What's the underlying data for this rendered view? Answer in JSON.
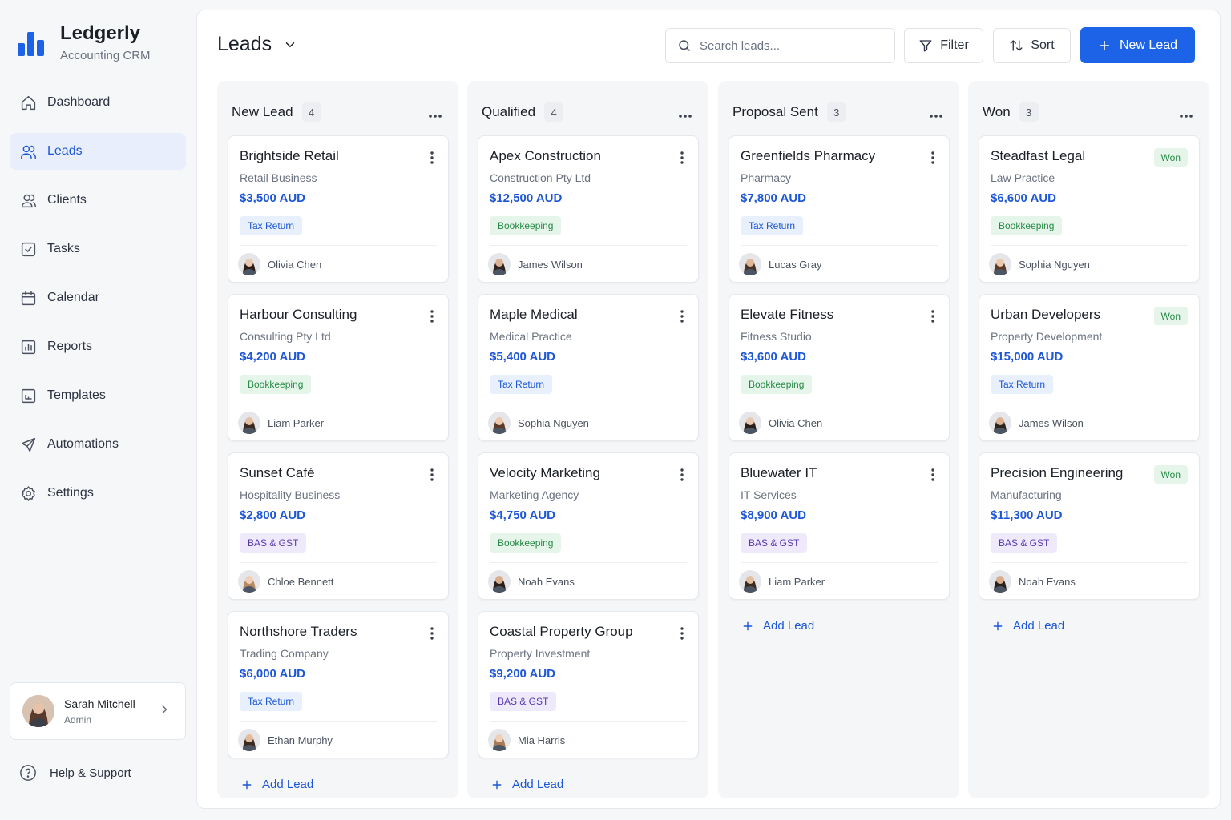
{
  "app": {
    "name": "Ledgerly",
    "subtitle": "Accounting CRM",
    "brand_color": "#1d63e8"
  },
  "sidebar": {
    "items": [
      {
        "label": "Dashboard",
        "icon": "home-icon",
        "active": false
      },
      {
        "label": "Leads",
        "icon": "users-icon",
        "active": true
      },
      {
        "label": "Clients",
        "icon": "people-icon",
        "active": false
      },
      {
        "label": "Tasks",
        "icon": "checkbox-icon",
        "active": false
      },
      {
        "label": "Calendar",
        "icon": "calendar-icon",
        "active": false
      },
      {
        "label": "Reports",
        "icon": "chart-icon",
        "active": false
      },
      {
        "label": "Templates",
        "icon": "template-icon",
        "active": false
      },
      {
        "label": "Automations",
        "icon": "rocket-icon",
        "active": false
      },
      {
        "label": "Settings",
        "icon": "gear-icon",
        "active": false
      }
    ],
    "user": {
      "name": "Sarah Mitchell",
      "role": "Admin"
    },
    "help_label": "Help & Support"
  },
  "header": {
    "title": "Leads",
    "search_placeholder": "Search leads...",
    "filter_label": "Filter",
    "sort_label": "Sort",
    "new_lead_label": "New Lead"
  },
  "board": {
    "add_lead_label": "Add Lead",
    "columns": [
      {
        "name": "New Lead",
        "count": "4",
        "cards": [
          {
            "title": "Brightside Retail",
            "type": "Retail Business",
            "amount": "$3,500 AUD",
            "tag": "Tax Return",
            "tag_kind": "tax",
            "owner": "Olivia Chen"
          },
          {
            "title": "Harbour Consulting",
            "type": "Consulting Pty Ltd",
            "amount": "$4,200 AUD",
            "tag": "Bookkeeping",
            "tag_kind": "book",
            "owner": "Liam Parker"
          },
          {
            "title": "Sunset Café",
            "type": "Hospitality Business",
            "amount": "$2,800 AUD",
            "tag": "BAS & GST",
            "tag_kind": "bas",
            "owner": "Chloe Bennett"
          },
          {
            "title": "Northshore Traders",
            "type": "Trading Company",
            "amount": "$6,000 AUD",
            "tag": "Tax Return",
            "tag_kind": "tax",
            "owner": "Ethan Murphy"
          }
        ]
      },
      {
        "name": "Qualified",
        "count": "4",
        "cards": [
          {
            "title": "Apex Construction",
            "type": "Construction Pty Ltd",
            "amount": "$12,500 AUD",
            "tag": "Bookkeeping",
            "tag_kind": "book",
            "owner": "James Wilson"
          },
          {
            "title": "Maple Medical",
            "type": "Medical Practice",
            "amount": "$5,400 AUD",
            "tag": "Tax Return",
            "tag_kind": "tax",
            "owner": "Sophia Nguyen"
          },
          {
            "title": "Velocity Marketing",
            "type": "Marketing Agency",
            "amount": "$4,750 AUD",
            "tag": "Bookkeeping",
            "tag_kind": "book",
            "owner": "Noah Evans"
          },
          {
            "title": "Coastal Property Group",
            "type": "Property Investment",
            "amount": "$9,200 AUD",
            "tag": "BAS & GST",
            "tag_kind": "bas",
            "owner": "Mia Harris"
          }
        ]
      },
      {
        "name": "Proposal Sent",
        "count": "3",
        "cards": [
          {
            "title": "Greenfields Pharmacy",
            "type": "Pharmacy",
            "amount": "$7,800 AUD",
            "tag": "Tax Return",
            "tag_kind": "tax",
            "owner": "Lucas Gray"
          },
          {
            "title": "Elevate Fitness",
            "type": "Fitness Studio",
            "amount": "$3,600 AUD",
            "tag": "Bookkeeping",
            "tag_kind": "book",
            "owner": "Olivia Chen"
          },
          {
            "title": "Bluewater IT",
            "type": "IT Services",
            "amount": "$8,900 AUD",
            "tag": "BAS & GST",
            "tag_kind": "bas",
            "owner": "Liam Parker"
          }
        ]
      },
      {
        "name": "Won",
        "count": "3",
        "cards": [
          {
            "title": "Steadfast Legal",
            "type": "Law Practice",
            "amount": "$6,600 AUD",
            "tag": "Bookkeeping",
            "tag_kind": "book",
            "owner": "Sophia Nguyen",
            "badge": "Won"
          },
          {
            "title": "Urban Developers",
            "type": "Property Development",
            "amount": "$15,000 AUD",
            "tag": "Tax Return",
            "tag_kind": "tax",
            "owner": "James Wilson",
            "badge": "Won"
          },
          {
            "title": "Precision Engineering",
            "type": "Manufacturing",
            "amount": "$11,300 AUD",
            "tag": "BAS & GST",
            "tag_kind": "bas",
            "owner": "Noah Evans",
            "badge": "Won"
          }
        ]
      }
    ]
  }
}
